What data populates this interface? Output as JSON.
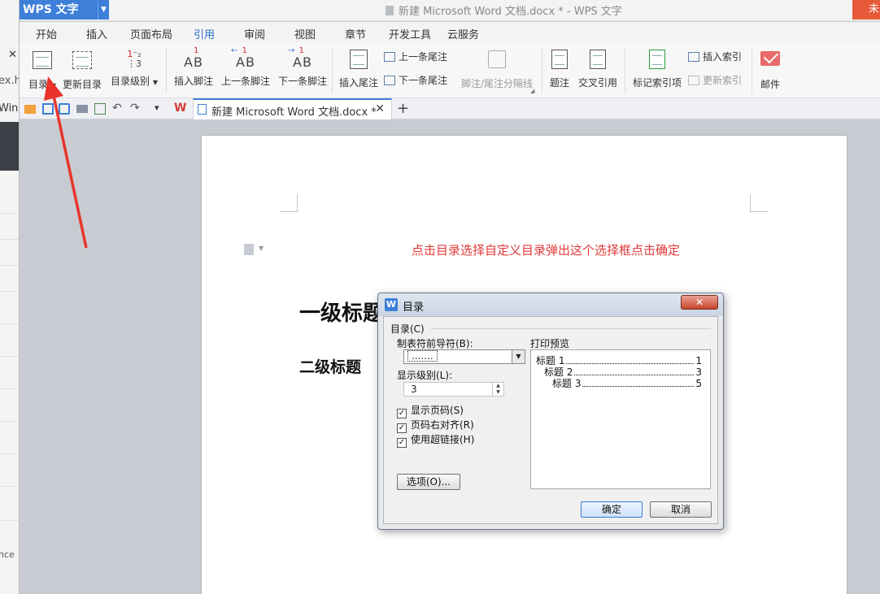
{
  "app": {
    "name": "WPS 文字",
    "window_title": "新建 Microsoft Word 文档.docx * - WPS 文字",
    "top_right": "未"
  },
  "left_strip": {
    "close": "✕",
    "t1": "ex.h",
    "t2": "Winc",
    "t3": "nce"
  },
  "menu": {
    "tabs": [
      "开始",
      "插入",
      "页面布局",
      "引用",
      "审阅",
      "视图",
      "章节",
      "开发工具",
      "云服务"
    ],
    "active": "引用"
  },
  "ribbon": {
    "toc": "目录",
    "update_toc": "更新目录",
    "toc_level": "目录级别",
    "insert_footnote": "插入脚注",
    "prev_footnote": "上一条脚注",
    "next_footnote": "下一条脚注",
    "insert_endnote": "插入尾注",
    "prev_endnote": "上一条尾注",
    "next_endnote": "下一条尾注",
    "separator_line": "脚注/尾注分隔线",
    "caption": "题注",
    "cross_ref": "交叉引用",
    "mark_index": "标记索引项",
    "insert_index": "插入索引",
    "update_index": "更新索引",
    "mail": "邮件"
  },
  "doc_tab": {
    "label": "新建 Microsoft Word 文档.docx *",
    "close": "✕",
    "new": "+"
  },
  "document": {
    "instruction": "点击目录选择自定义目录弹出这个选择框点击确定",
    "heading1": "一级标题",
    "heading2": "二级标题"
  },
  "dialog": {
    "title": "目录",
    "close": "✕",
    "group": "目录(C)",
    "leader_label": "制表符前导符(B):",
    "leader_value": ".......",
    "level_label": "显示级别(L):",
    "level_value": "3",
    "cb_page_numbers": "显示页码(S)",
    "cb_right_align": "页码右对齐(R)",
    "cb_hyperlinks": "使用超链接(H)",
    "options_button": "选项(O)...",
    "preview_label": "打印预览",
    "preview": [
      {
        "text": "标题 1",
        "page": "1"
      },
      {
        "text": "标题 2",
        "page": "3"
      },
      {
        "text": "标题 3",
        "page": "5"
      }
    ],
    "ok": "确定",
    "cancel": "取消"
  }
}
